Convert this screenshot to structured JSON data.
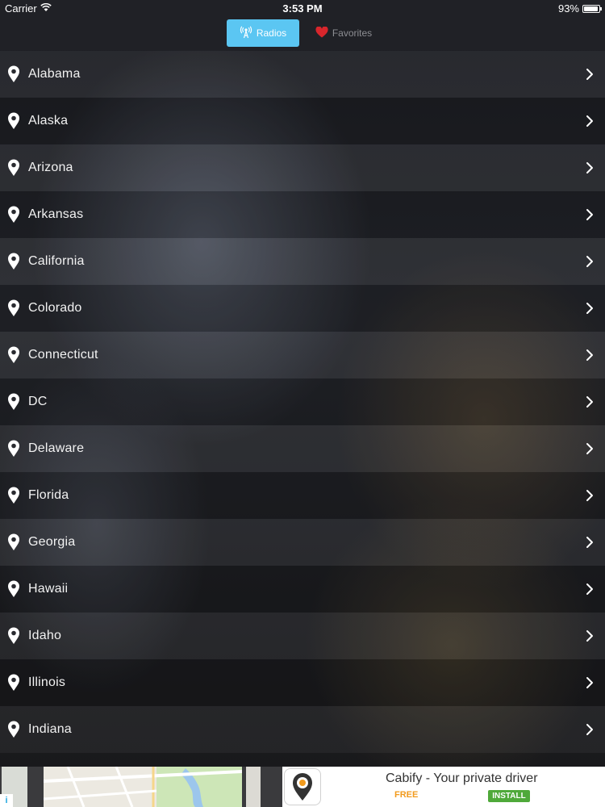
{
  "status_bar": {
    "carrier": "Carrier",
    "time": "3:53 PM",
    "battery_text": "93%",
    "battery_level": 0.93
  },
  "nav": {
    "radios_label": "Radios",
    "favorites_label": "Favorites",
    "selected": "Radios",
    "accent_color": "#5bc6f2",
    "heart_color": "#d8262c"
  },
  "states": [
    "Alabama",
    "Alaska",
    "Arizona",
    "Arkansas",
    "California",
    "Colorado",
    "Connecticut",
    "DC",
    "Delaware",
    "Florida",
    "Georgia",
    "Hawaii",
    "Idaho",
    "Illinois",
    "Indiana"
  ],
  "icons": {
    "row_leading": "location-pin-icon",
    "row_trailing": "chevron-right-icon",
    "radios": "radio-antenna-icon",
    "favorites": "heart-icon"
  },
  "ad": {
    "title": "Cabify - Your private driver",
    "price": "FREE",
    "install_label": "INSTALL",
    "info_label": "i"
  }
}
